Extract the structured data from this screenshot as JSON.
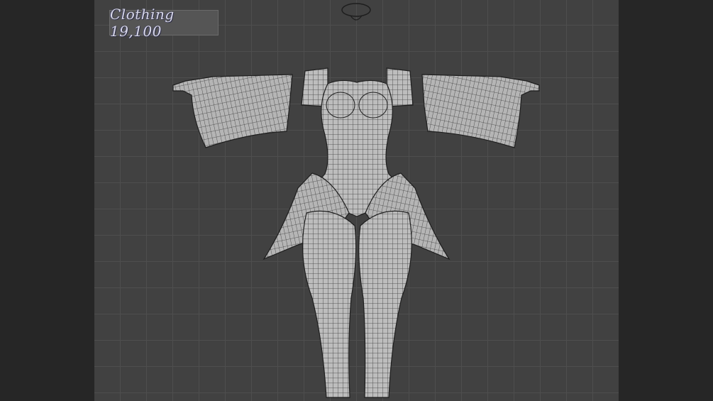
{
  "viewport": {
    "overlay_label": "Clothing 19,100",
    "background_color": "#414141",
    "grid_color": "#4e4e4e",
    "mesh_color": "#bdbdbd",
    "wire_color": "#3a3a3a"
  },
  "model": {
    "subject": "wireframe-clothing-mesh"
  }
}
